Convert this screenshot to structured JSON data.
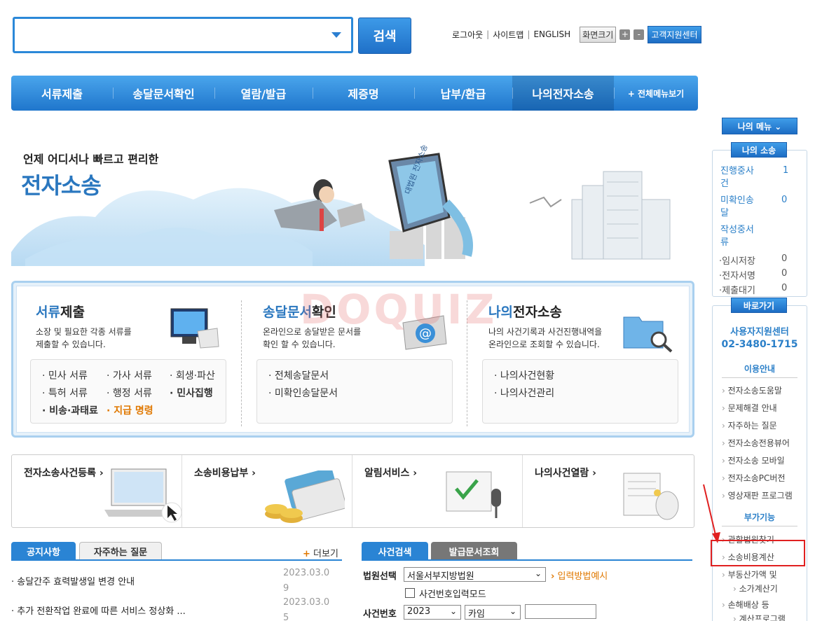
{
  "search": {
    "value": "",
    "button": "검색"
  },
  "toplinks": {
    "logout": "로그아웃",
    "sitemap": "사이트맵",
    "english": "ENGLISH",
    "sep": "|",
    "screen_size": "화면크기",
    "zoom_in": "+",
    "zoom_out": "-",
    "support": "고객지원센터"
  },
  "nav": {
    "items": [
      "서류제출",
      "송달문서확인",
      "열람/발급",
      "제증명",
      "납부/환급",
      "나의전자소송"
    ],
    "all_menu": "+ 전체메뉴보기"
  },
  "hero": {
    "subtitle": "언제 어디서나 빠르고 편리한",
    "title": "전자소송",
    "sign_text": "대법원 전자소송"
  },
  "watermark": "DOQUIZ",
  "services": [
    {
      "title_hl": "서류",
      "title_rest": "제출",
      "desc": "소장 및 필요한 각종 서류를\n제출할 수 있습니다.",
      "items": [
        "· 민사 서류",
        "· 가사 서류",
        "· 회생·파산",
        "· 특허 서류",
        "· 행정 서류",
        "· 민사집행",
        "· 비송·과태료",
        "· 지급 명령"
      ]
    },
    {
      "title_hl": "송달문서",
      "title_rest": "확인",
      "desc": "온라인으로 송달받은 문서를\n확인 할 수 있습니다.",
      "items": [
        "· 전체송달문서",
        "· 미확인송달문서"
      ]
    },
    {
      "title_hl": "나의",
      "title_rest": "전자소송",
      "desc": "나의 사건기록과 사건진행내역을\n온라인으로 조회할 수 있습니다.",
      "items": [
        "· 나의사건현황",
        "· 나의사건관리"
      ]
    }
  ],
  "quick": [
    "전자소송사건등록 ›",
    "소송비용납부 ›",
    "알림서비스 ›",
    "나의사건열람 ›"
  ],
  "notice": {
    "tabs": [
      "공지사항",
      "자주하는 질문"
    ],
    "more_plus": "+",
    "more": "더보기",
    "rows": [
      {
        "title": "· 송달간주 효력발생일 변경 안내",
        "date": "2023.03.0\n9"
      },
      {
        "title": "· 추가 전환작업 완료에 따른 서비스 정상화 ...",
        "date": "2023.03.0\n5"
      }
    ]
  },
  "case_search": {
    "tabs": [
      "사건검색",
      "발급문서조회"
    ],
    "court_label": "법원선택",
    "court_value": "서울서부지방법원",
    "input_example": "입력방법예시",
    "mode_label": "사건번호입력모드",
    "case_no_label": "사건번호",
    "year": "2023",
    "type": "카임"
  },
  "sidebar": {
    "my_menu": "나의 메뉴 ⌄",
    "my_case_title": "나의 소송",
    "counts": [
      {
        "label": "진행중사",
        "label2": "건",
        "value": "1"
      },
      {
        "label": "미확인송",
        "label2": "달",
        "value": "0"
      },
      {
        "label": "작성중서",
        "label2": "류",
        "value": ""
      },
      {
        "label": "·임시저장",
        "value": "0"
      },
      {
        "label": "·전자서명",
        "value": "0"
      },
      {
        "label": "·제출대기",
        "value": "0"
      }
    ],
    "shortcut": "바로가기",
    "center_name": "사용자지원센터",
    "center_phone": "02-3480-1715",
    "guide_title": "이용안내",
    "guide": [
      "전자소송도움말",
      "문제해결 안내",
      "자주하는 질문",
      "전자소송전용뷰어",
      "전자소송 모바일",
      "전자소송PC버전",
      "영상재판 프로그램"
    ],
    "extra_title": "부가기능",
    "extra": [
      "관할법원찾기",
      "소송비용계산",
      "부동산가액 및",
      "소가계산기",
      "손해배상 등",
      "계산프로그램"
    ]
  }
}
